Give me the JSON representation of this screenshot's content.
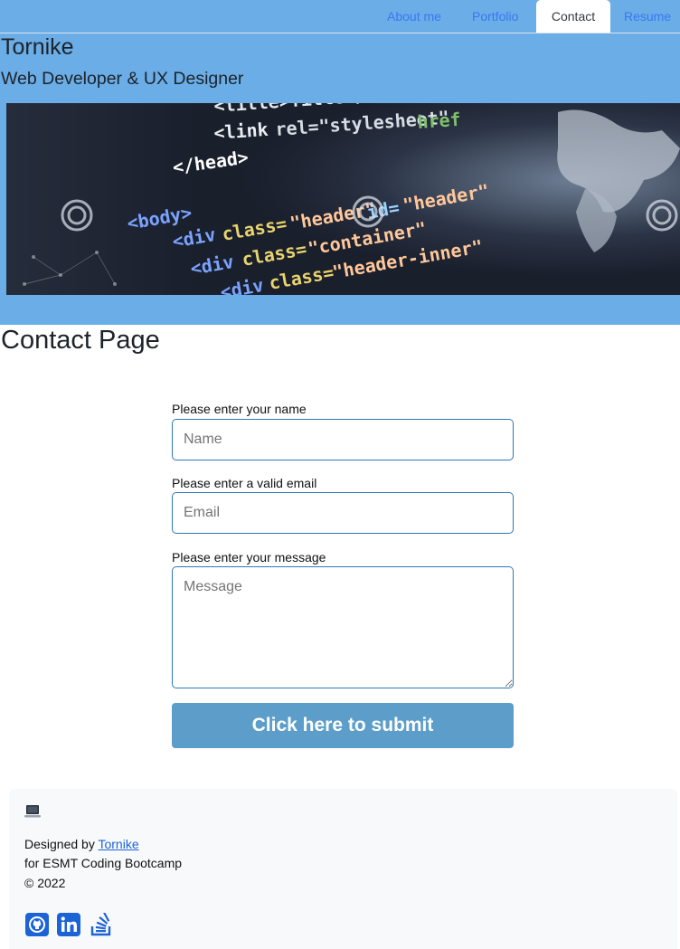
{
  "nav": {
    "items": [
      {
        "label": "About me"
      },
      {
        "label": "Portfolio"
      },
      {
        "label": "Contact",
        "active": true
      },
      {
        "label": "Resume"
      }
    ]
  },
  "header": {
    "name": "Tornike",
    "role": "Web Developer & UX Designer",
    "hero_icon": "code-banner-image"
  },
  "main": {
    "title": "Contact Page",
    "form": {
      "name_label": "Please enter your name",
      "name_placeholder": "Name",
      "email_label": "Please enter a valid email",
      "email_placeholder": "Email",
      "message_label": "Please enter your message",
      "message_placeholder": "Message",
      "submit_label": "Click here to submit"
    }
  },
  "footer": {
    "icon": "laptop-icon",
    "designed_prefix": "Designed by ",
    "designed_link": "Tornike",
    "line2": "for ESMT Coding Bootcamp",
    "copyright": "© 2022",
    "social": [
      "github-icon",
      "linkedin-icon",
      "stackoverflow-icon"
    ]
  },
  "colors": {
    "header_bg": "#6aade7",
    "accent": "#3a78f2",
    "submit_bg": "#5c9ec9",
    "field_border": "#2f77b5"
  }
}
